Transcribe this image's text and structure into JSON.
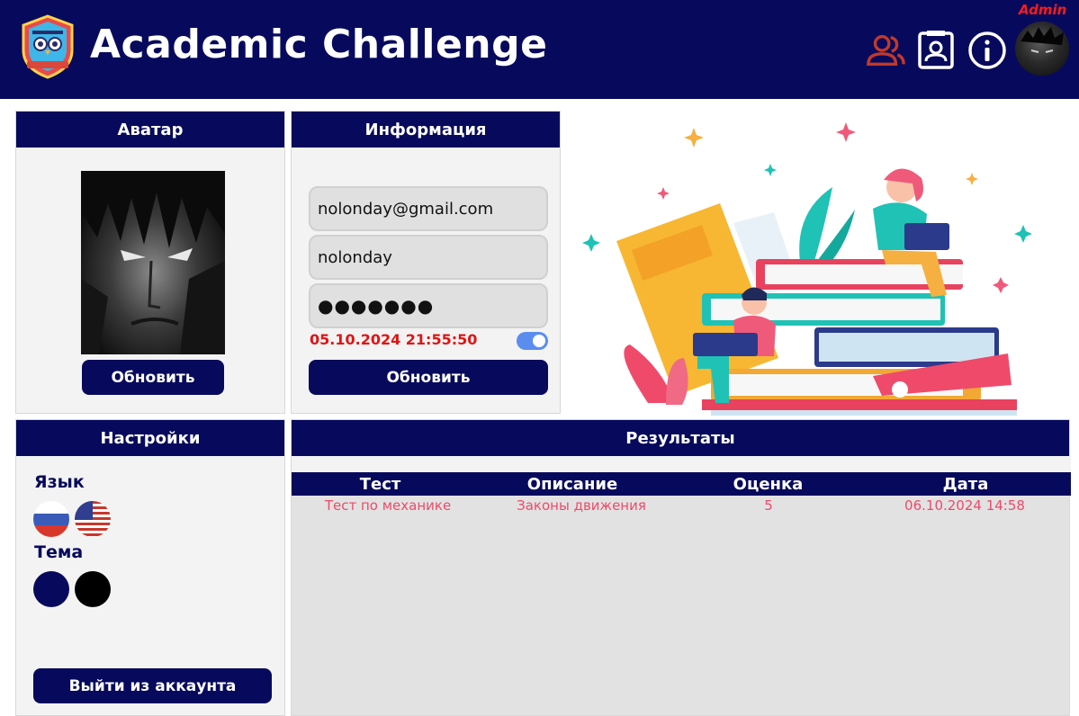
{
  "header": {
    "app_title": "Academic Challenge",
    "role_label": "Admin",
    "icons": [
      "users-icon",
      "profile-card-icon",
      "info-icon",
      "user-avatar"
    ]
  },
  "avatar_panel": {
    "title": "Аватар",
    "update_label": "Обновить"
  },
  "info_panel": {
    "title": "Информация",
    "email": "nolonday@gmail.com",
    "username": "nolonday",
    "password_mask": "●●●●●●●",
    "timestamp": "05.10.2024 21:55:50",
    "toggle_on": true,
    "update_label": "Обновить"
  },
  "settings_panel": {
    "title": "Настройки",
    "language_label": "Язык",
    "languages": [
      "ru-flag",
      "us-flag"
    ],
    "theme_label": "Тема",
    "themes": [
      "#070a5c",
      "#000000"
    ],
    "logout_label": "Выйти из аккаунта"
  },
  "results_panel": {
    "title": "Результаты",
    "columns": [
      "Тест",
      "Описание",
      "Оценка",
      "Дата"
    ],
    "rows": [
      [
        "Тест по механике",
        "Законы движения",
        "5",
        "06.10.2024 14:58"
      ]
    ]
  },
  "colors": {
    "navy": "#070a5c",
    "alert_red": "#e01414",
    "row_text": "#ef4a6a",
    "toggle": "#5b8def"
  }
}
